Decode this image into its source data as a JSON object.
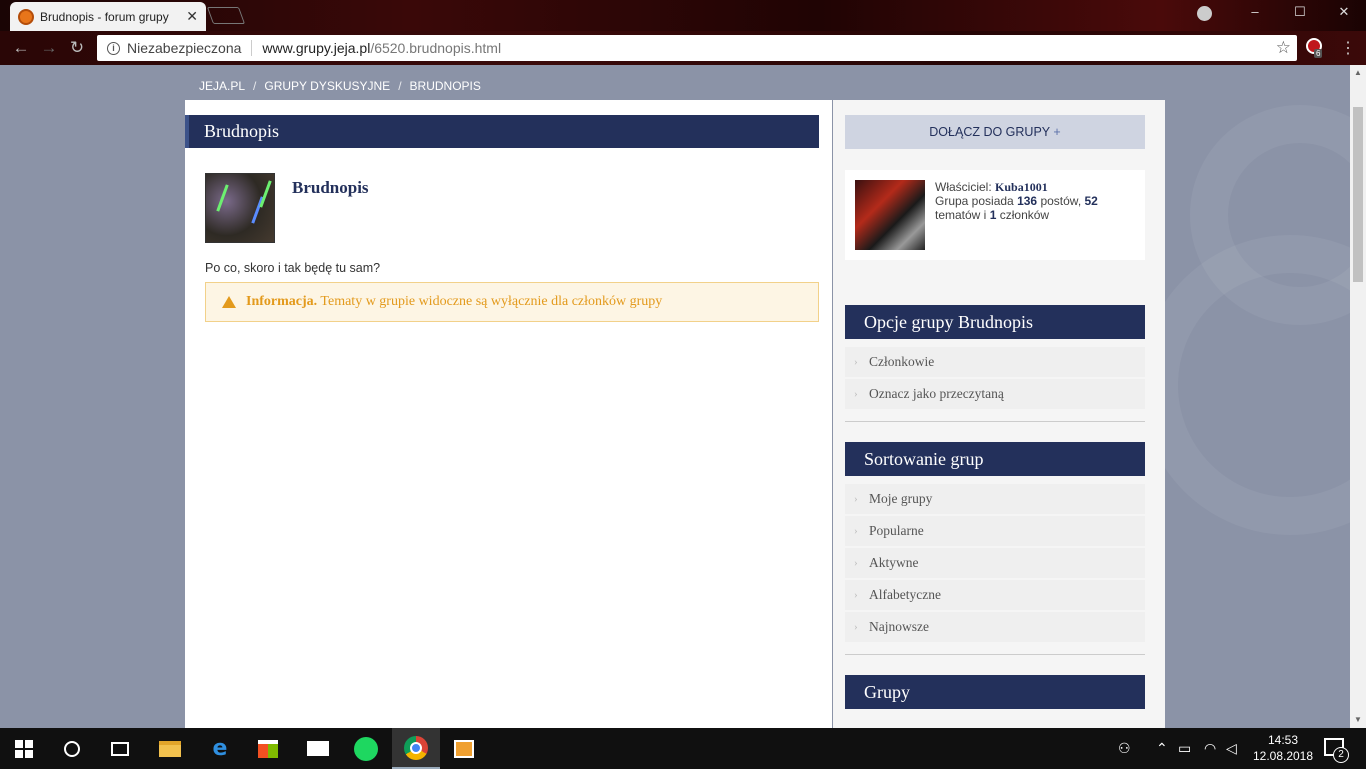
{
  "browser": {
    "tab_title": "Brudnopis - forum grupy",
    "tab_close": "✕",
    "security_label": "Niezabezpieczona",
    "url_host": "www.grupy.jeja.pl",
    "url_path": "/6520.brudnopis.html",
    "extension_badge": "6"
  },
  "breadcrumb": {
    "items": [
      "JEJA.PL",
      "GRUPY DYSKUSYJNE",
      "BRUDNOPIS"
    ],
    "separator": "/"
  },
  "main": {
    "header_title": "Brudnopis",
    "group_name": "Brudnopis",
    "description": "Po co, skoro i tak będę tu sam?",
    "alert_strong": "Informacja.",
    "alert_text": "Tematy w grupie widoczne są wyłącznie dla członków grupy"
  },
  "sidebar": {
    "join_label": "DOŁĄCZ DO GRUPY",
    "join_plus": "+",
    "owner": {
      "label": "Właściciel:",
      "name": "Kuba1001",
      "posts_prefix": "Grupa posiada",
      "posts": "136",
      "posts_suffix": "postów,",
      "topics": "52",
      "topics_suffix": "tematów i",
      "members": "1",
      "members_suffix": "członków"
    },
    "options_title": "Opcje grupy Brudnopis",
    "options": [
      "Członkowie",
      "Oznacz jako przeczytaną"
    ],
    "sort_title": "Sortowanie grup",
    "sort": [
      "Moje grupy",
      "Popularne",
      "Aktywne",
      "Alfabetyczne",
      "Najnowsze"
    ],
    "groups_title": "Grupy"
  },
  "taskbar": {
    "time": "14:53",
    "date": "12.08.2018",
    "notifications": "2"
  },
  "colors": {
    "navy": "#23305b",
    "alert": "#e39a1c",
    "page_bg": "#8b93a7"
  }
}
